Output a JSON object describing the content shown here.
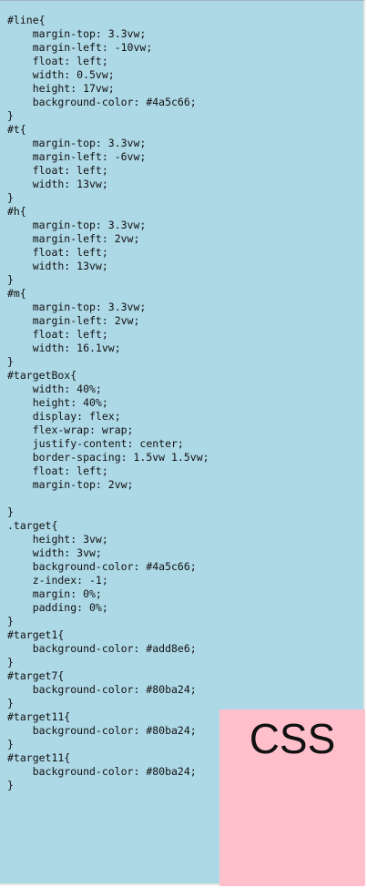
{
  "code_lines": [
    "#line{",
    "    margin-top: 3.3vw;",
    "    margin-left: -10vw;",
    "    float: left;",
    "    width: 0.5vw;",
    "    height: 17vw;",
    "    background-color: #4a5c66;",
    "}",
    "#t{",
    "    margin-top: 3.3vw;",
    "    margin-left: -6vw;",
    "    float: left;",
    "    width: 13vw;",
    "}",
    "#h{",
    "    margin-top: 3.3vw;",
    "    margin-left: 2vw;",
    "    float: left;",
    "    width: 13vw;",
    "}",
    "#m{",
    "    margin-top: 3.3vw;",
    "    margin-left: 2vw;",
    "    float: left;",
    "    width: 16.1vw;",
    "}",
    "#targetBox{",
    "    width: 40%;",
    "    height: 40%;",
    "    display: flex;",
    "    flex-wrap: wrap;",
    "    justify-content: center;",
    "    border-spacing: 1.5vw 1.5vw;",
    "    float: left;",
    "    margin-top: 2vw;",
    "",
    "}",
    ".target{",
    "    height: 3vw;",
    "    width: 3vw;",
    "    background-color: #4a5c66;",
    "    z-index: -1;",
    "    margin: 0%;",
    "    padding: 0%;",
    "}",
    "#target1{",
    "    background-color: #add8e6;",
    "}",
    "#target7{",
    "    background-color: #80ba24;",
    "}",
    "#target11{",
    "    background-color: #80ba24;",
    "}",
    "#target11{",
    "    background-color: #80ba24;",
    "}"
  ],
  "css_box": {
    "label": "CSS"
  },
  "colors": {
    "page_background": "#add8e6",
    "box_background": "#ffc0cb",
    "text": "#111111"
  }
}
